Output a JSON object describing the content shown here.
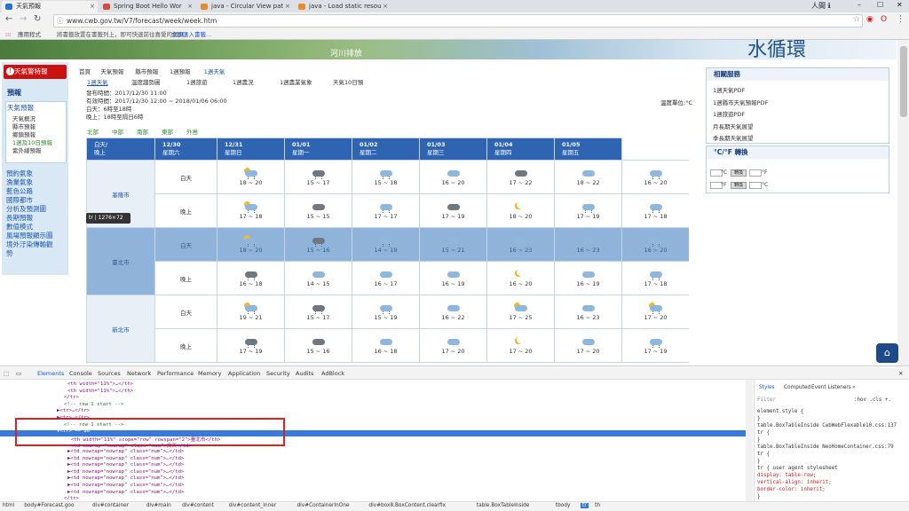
{
  "tabs": [
    {
      "label": "天氣預報",
      "color": "#2a6fd6",
      "active": true
    },
    {
      "label": "Spring Boot Hello Wor",
      "color": "#d94a3a",
      "active": false
    },
    {
      "label": "java - Circular View pat",
      "color": "#e68a2e",
      "active": false
    },
    {
      "label": "java - Load static resou",
      "color": "#e68a2e",
      "active": false
    }
  ],
  "window": {
    "user": "人間 ℹ",
    "min": "–",
    "max": "☐",
    "close": "✕"
  },
  "nav": {
    "back": "←",
    "forward": "→",
    "reload": "↻",
    "url": "www.cwb.gov.tw/V7/forecast/week/week.htm"
  },
  "bookmarks": {
    "apps": "應用程式",
    "hint": "將書籤放置在書籤列上，即可快速前往喜愛的網頁。",
    "import": "立即匯入書籤..."
  },
  "banner": {
    "small": "河川排放",
    "big": "水循環"
  },
  "sidebar": {
    "warn": "天氣警特報",
    "forecast_head": "預報",
    "main_link": "天氣預報",
    "sub": [
      "天氣概況",
      "縣市預報",
      "鄉鎮預報",
      "1週及10日預報",
      "紫外線預報"
    ],
    "links": [
      "預約氣象",
      "漁業氣象",
      "藍色公路",
      "國際都市",
      "分析及預測圖",
      "長期預報",
      "數值模式",
      "風場預報顯示圖",
      "境外汙染傳輸觀",
      "勢"
    ]
  },
  "breadcrumb": [
    "首頁",
    "天氣預報",
    "縣市預報",
    "1週預報",
    "1週天氣"
  ],
  "subnav": [
    "1週天氣",
    "溫度趨勢圖",
    "1週旅遊",
    "1週農況",
    "1週農業氣象",
    "天氣10日預"
  ],
  "info": {
    "issued": "發布時間：2017/12/30 11:00",
    "valid": "有效時間：2017/12/30 12:00 ~ 2018/01/06 06:00",
    "day": "白天：6時至18時",
    "night": "晚上：18時至隔日6時",
    "unit": "溫度單位:°C"
  },
  "regions": [
    "北部",
    "中部",
    "南部",
    "東部",
    "外島"
  ],
  "table": {
    "corner": [
      "白天/",
      "晚上"
    ],
    "dates": [
      {
        "date": "12/30",
        "dow": "星期六"
      },
      {
        "date": "12/31",
        "dow": "星期日"
      },
      {
        "date": "01/01",
        "dow": "星期一"
      },
      {
        "date": "01/02",
        "dow": "星期二"
      },
      {
        "date": "01/03",
        "dow": "星期三"
      },
      {
        "date": "01/04",
        "dow": "星期四"
      },
      {
        "date": "01/05",
        "dow": "星期五"
      }
    ],
    "cities": [
      {
        "name": "基隆市",
        "rows": [
          {
            "period": "白天",
            "cells": [
              [
                "rain-sun",
                "18 ~ 20"
              ],
              [
                "rain-dark",
                "15 ~ 17"
              ],
              [
                "rain",
                "15 ~ 18"
              ],
              [
                "cloud",
                "16 ~ 20"
              ],
              [
                "dark",
                "17 ~ 22"
              ],
              [
                "cloud",
                "18 ~ 22"
              ],
              [
                "rain",
                "16 ~ 20"
              ]
            ]
          },
          {
            "period": "晚上",
            "cells": [
              [
                "rain-sun",
                "17 ~ 18"
              ],
              [
                "dark",
                "15 ~ 15"
              ],
              [
                "rain",
                "17 ~ 17"
              ],
              [
                "dark",
                "17 ~ 19"
              ],
              [
                "moon",
                "18 ~ 20"
              ],
              [
                "rain",
                "17 ~ 19"
              ],
              [
                "rain",
                "17 ~ 18"
              ]
            ]
          }
        ]
      },
      {
        "name": "臺北市",
        "rows": [
          {
            "period": "白天",
            "cells": [
              [
                "rain-sun",
                "18 ~ 20"
              ],
              [
                "rain-dark",
                "15 ~ 16"
              ],
              [
                "rain",
                "14 ~ 19"
              ],
              [
                "cloud",
                "15 ~ 21"
              ],
              [
                "cloud",
                "16 ~ 23"
              ],
              [
                "cloud",
                "16 ~ 23"
              ],
              [
                "rain",
                "16 ~ 20"
              ]
            ]
          },
          {
            "period": "晚上",
            "cells": [
              [
                "rain-dark",
                "16 ~ 18"
              ],
              [
                "cloud",
                "14 ~ 15"
              ],
              [
                "cloud",
                "16 ~ 17"
              ],
              [
                "cloud",
                "16 ~ 19"
              ],
              [
                "moon",
                "16 ~ 20"
              ],
              [
                "cloud",
                "16 ~ 19"
              ],
              [
                "rain",
                "17 ~ 18"
              ]
            ]
          }
        ]
      },
      {
        "name": "新北市",
        "rows": [
          {
            "period": "白天",
            "cells": [
              [
                "rain-sun",
                "19 ~ 21"
              ],
              [
                "rain-dark",
                "15 ~ 17"
              ],
              [
                "rain",
                "15 ~ 19"
              ],
              [
                "cloud",
                "16 ~ 22"
              ],
              [
                "sun-cloud",
                "17 ~ 25"
              ],
              [
                "cloud",
                "16 ~ 23"
              ],
              [
                "rain-sun",
                "17 ~ 20"
              ]
            ]
          },
          {
            "period": "晚上",
            "cells": [
              [
                "rain-dark",
                "17 ~ 19"
              ],
              [
                "dark",
                "15 ~ 16"
              ],
              [
                "cloud",
                "16 ~ 18"
              ],
              [
                "cloud",
                "17 ~ 20"
              ],
              [
                "moon",
                "17 ~ 20"
              ],
              [
                "cloud",
                "17 ~ 20"
              ],
              [
                "rain",
                "17 ~ 19"
              ]
            ]
          }
        ]
      }
    ]
  },
  "tooltip": "tr | 1276×72",
  "right": {
    "services_head": "相關服務",
    "services": [
      "1週天氣PDF",
      "1週縣市天氣預報PDF",
      "1週旅遊PDF",
      "月長期天氣展望",
      "季長期天氣展望"
    ],
    "conv_head": "°C/°F 轉換",
    "conv": [
      "°C",
      "轉換",
      "°F",
      "°F",
      "轉換",
      "°C"
    ]
  },
  "devtools": {
    "tabs": [
      "Elements",
      "Console",
      "Sources",
      "Network",
      "Performance",
      "Memory",
      "Application",
      "Security",
      "Audits",
      "AdBlock"
    ],
    "code": [
      {
        "indent": 76,
        "text": "<th width=\"11%\">…</th>",
        "kind": "tag"
      },
      {
        "indent": 76,
        "text": "<th width=\"11%\">…</th>",
        "kind": "tag"
      },
      {
        "indent": 72,
        "text": "</tr>",
        "kind": "tag"
      },
      {
        "indent": 72,
        "text": "<!-- row 1 start -->",
        "kind": "comment"
      },
      {
        "indent": 64,
        "text": "▶<tr>…</tr>",
        "kind": "tag"
      },
      {
        "indent": 64,
        "text": "▶<tr>…</tr>",
        "kind": "tag"
      },
      {
        "indent": 72,
        "text": "<!-- row 1 start -->",
        "kind": "comment"
      },
      {
        "indent": 64,
        "text": "▼<tr> == $0",
        "kind": "sel"
      },
      {
        "indent": 80,
        "text": "<th width=\"11%\" scope=\"row\" rowspan=\"2\">臺北市</th>",
        "kind": "tag"
      },
      {
        "indent": 80,
        "text": "<td nowrap=\"nowrap\" class=\"num\">白天</td>",
        "kind": "tag"
      },
      {
        "indent": 76,
        "text": "▶<td nowrap=\"nowrap\" class=\"num\">…</td>",
        "kind": "tag"
      },
      {
        "indent": 76,
        "text": "▶<td nowrap=\"nowrap\" class=\"num\">…</td>",
        "kind": "tag"
      },
      {
        "indent": 76,
        "text": "▶<td nowrap=\"nowrap\" class=\"num\">…</td>",
        "kind": "tag"
      },
      {
        "indent": 76,
        "text": "▶<td nowrap=\"nowrap\" class=\"num\">…</td>",
        "kind": "tag"
      },
      {
        "indent": 76,
        "text": "▶<td nowrap=\"nowrap\" class=\"num\">…</td>",
        "kind": "tag"
      },
      {
        "indent": 76,
        "text": "▶<td nowrap=\"nowrap\" class=\"num\">…</td>",
        "kind": "tag"
      },
      {
        "indent": 76,
        "text": "▶<td nowrap=\"nowrap\" class=\"num\">…</td>",
        "kind": "tag"
      },
      {
        "indent": 72,
        "text": "</tr>",
        "kind": "tag"
      }
    ],
    "styles_tabs": [
      "Styles",
      "Computed",
      "Event Listeners",
      "»"
    ],
    "filter": "Filter",
    "filter_opts": ":hov  .cls  +.",
    "styles": [
      "element.style {",
      "}",
      "table.BoxTableInside  CwbWebFlexable10.css:137",
      "tr {",
      "}",
      "table.BoxTableInside  NeoHomeContainer.css:79",
      "tr {",
      "}",
      "tr {                user agent stylesheet",
      "  display: table-row;",
      "  vertical-align: inherit;",
      "  border-color: inherit;",
      "}"
    ],
    "crumbs": [
      "html",
      "body#Forecast.goo",
      "div#container",
      "div#main",
      "div#content",
      "div#content_inner",
      "div#ContainerInOne",
      "div#box8.BoxContent.clearfix",
      "table.BoxTableInside",
      "tbody",
      "tr",
      "th"
    ]
  }
}
